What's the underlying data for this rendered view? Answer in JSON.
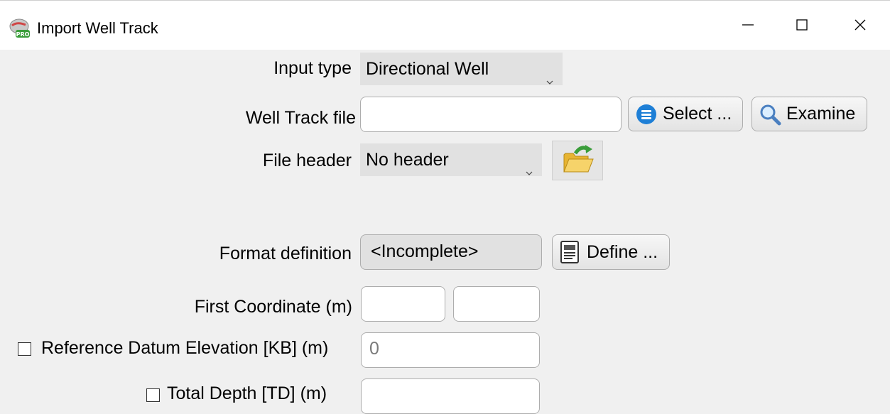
{
  "window": {
    "title": "Import Well Track",
    "controls": {
      "minimize": "minimize-icon",
      "maximize": "maximize-icon",
      "close": "close-icon"
    }
  },
  "form": {
    "input_type": {
      "label": "Input type",
      "value": "Directional Well"
    },
    "well_track_file": {
      "label": "Well Track file",
      "value": "",
      "select_label": "Select ...",
      "examine_label": "Examine"
    },
    "file_header": {
      "label": "File header",
      "value": "No header"
    },
    "format_definition": {
      "label": "Format definition",
      "value": "<Incomplete>",
      "define_label": "Define ..."
    },
    "first_coordinate": {
      "label": "First Coordinate (m)",
      "x_value": "",
      "y_value": ""
    },
    "reference_datum": {
      "label": "Reference Datum Elevation [KB] (m)",
      "checked": false,
      "placeholder": "0"
    },
    "total_depth": {
      "label": "Total Depth [TD] (m)",
      "checked": false,
      "value": ""
    }
  },
  "icons": {
    "app": "app-pro-icon",
    "select": "list-icon",
    "examine": "magnifier-icon",
    "open_file": "folder-open-icon",
    "define": "document-definition-icon"
  },
  "colors": {
    "accent_blue": "#1e7fd6",
    "folder_yellow": "#f2c84b",
    "arrow_green": "#3a9d3a"
  }
}
